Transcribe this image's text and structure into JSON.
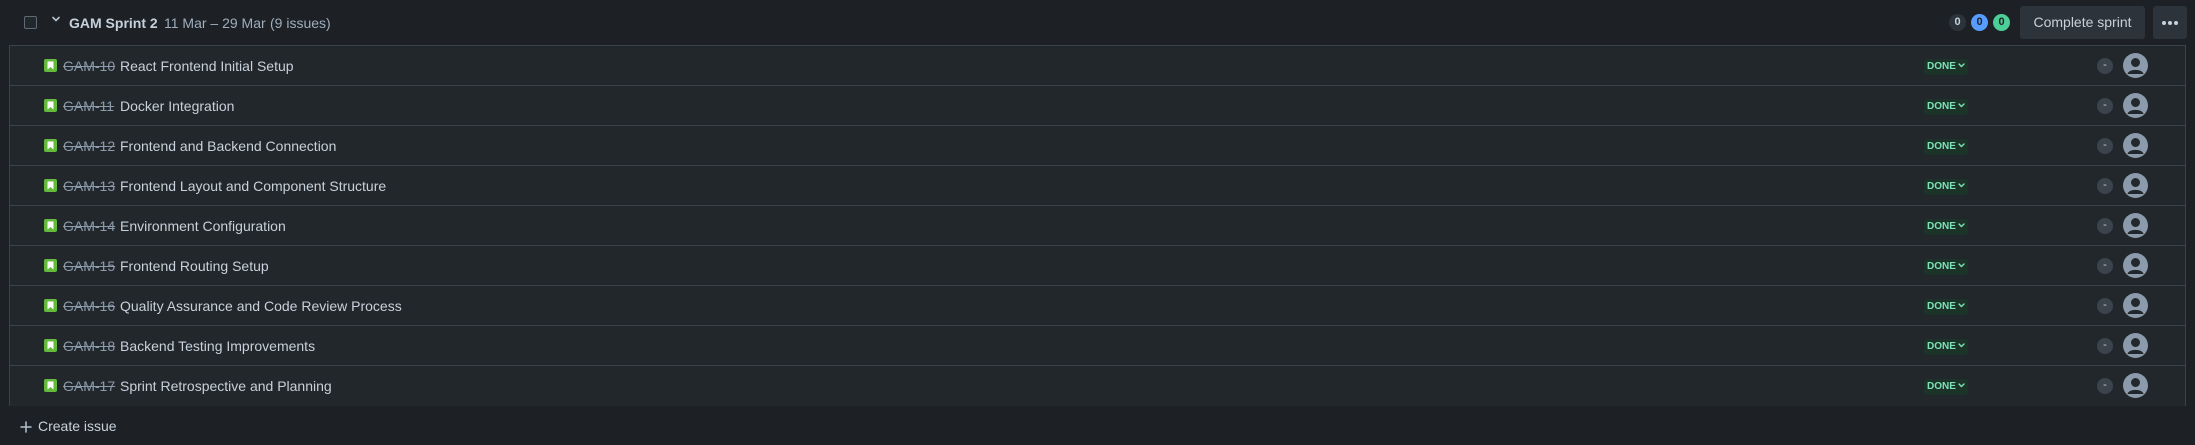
{
  "header": {
    "sprint_name": "GAM Sprint 2",
    "dates": "11 Mar – 29 Mar",
    "issue_count": "(9 issues)",
    "counts": {
      "todo": "0",
      "in_progress": "0",
      "done": "0"
    },
    "complete_label": "Complete sprint"
  },
  "issues": [
    {
      "key": "GAM-10",
      "summary": "React Frontend Initial Setup",
      "status": "DONE",
      "estimate": "-"
    },
    {
      "key": "GAM-11",
      "summary": "Docker Integration",
      "status": "DONE",
      "estimate": "-"
    },
    {
      "key": "GAM-12",
      "summary": "Frontend and Backend Connection",
      "status": "DONE",
      "estimate": "-"
    },
    {
      "key": "GAM-13",
      "summary": "Frontend Layout and Component Structure",
      "status": "DONE",
      "estimate": "-"
    },
    {
      "key": "GAM-14",
      "summary": "Environment Configuration",
      "status": "DONE",
      "estimate": "-"
    },
    {
      "key": "GAM-15",
      "summary": "Frontend Routing Setup",
      "status": "DONE",
      "estimate": "-"
    },
    {
      "key": "GAM-16",
      "summary": "Quality Assurance and Code Review Process",
      "status": "DONE",
      "estimate": "-"
    },
    {
      "key": "GAM-18",
      "summary": "Backend Testing Improvements",
      "status": "DONE",
      "estimate": "-"
    },
    {
      "key": "GAM-17",
      "summary": "Sprint Retrospective and Planning",
      "status": "DONE",
      "estimate": "-"
    }
  ],
  "footer": {
    "create_label": "Create issue"
  },
  "icons": {
    "issue_type": "story-icon",
    "assignee": "avatar-icon",
    "status_dropdown": "chevron-down-icon"
  },
  "colors": {
    "background": "#1d2125",
    "row_background": "#22272b",
    "story": "#63ba3c",
    "done_text": "#7ee2b8",
    "in_progress_pill": "#579dff",
    "done_pill": "#4bce97"
  }
}
